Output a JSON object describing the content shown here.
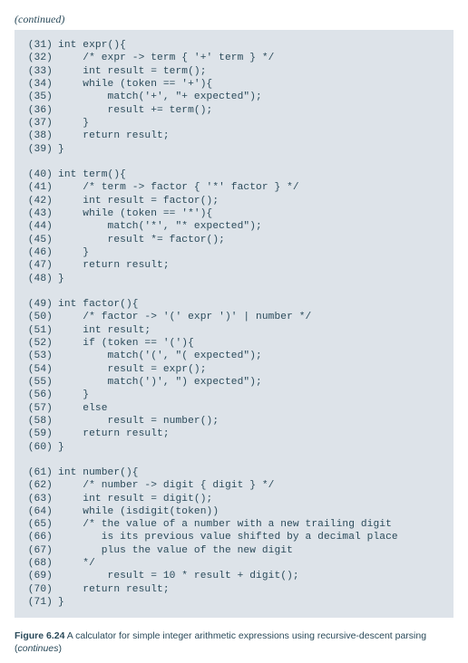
{
  "header": {
    "continued_label": "(continued)"
  },
  "code": {
    "lines": [
      {
        "n": "(31)",
        "t": "int expr(){"
      },
      {
        "n": "(32)",
        "t": "    /* expr -> term { '+' term } */"
      },
      {
        "n": "(33)",
        "t": "    int result = term();"
      },
      {
        "n": "(34)",
        "t": "    while (token == '+'){"
      },
      {
        "n": "(35)",
        "t": "        match('+', \"+ expected\");"
      },
      {
        "n": "(36)",
        "t": "        result += term();"
      },
      {
        "n": "(37)",
        "t": "    }"
      },
      {
        "n": "(38)",
        "t": "    return result;"
      },
      {
        "n": "(39)",
        "t": "}"
      },
      {
        "blank": true
      },
      {
        "n": "(40)",
        "t": "int term(){"
      },
      {
        "n": "(41)",
        "t": "    /* term -> factor { '*' factor } */"
      },
      {
        "n": "(42)",
        "t": "    int result = factor();"
      },
      {
        "n": "(43)",
        "t": "    while (token == '*'){"
      },
      {
        "n": "(44)",
        "t": "        match('*', \"* expected\");"
      },
      {
        "n": "(45)",
        "t": "        result *= factor();"
      },
      {
        "n": "(46)",
        "t": "    }"
      },
      {
        "n": "(47)",
        "t": "    return result;"
      },
      {
        "n": "(48)",
        "t": "}"
      },
      {
        "blank": true
      },
      {
        "n": "(49)",
        "t": "int factor(){"
      },
      {
        "n": "(50)",
        "t": "    /* factor -> '(' expr ')' | number */"
      },
      {
        "n": "(51)",
        "t": "    int result;"
      },
      {
        "n": "(52)",
        "t": "    if (token == '('){"
      },
      {
        "n": "(53)",
        "t": "        match('(', \"( expected\");"
      },
      {
        "n": "(54)",
        "t": "        result = expr();"
      },
      {
        "n": "(55)",
        "t": "        match(')', \") expected\");"
      },
      {
        "n": "(56)",
        "t": "    }"
      },
      {
        "n": "(57)",
        "t": "    else"
      },
      {
        "n": "(58)",
        "t": "        result = number();"
      },
      {
        "n": "(59)",
        "t": "    return result;"
      },
      {
        "n": "(60)",
        "t": "}"
      },
      {
        "blank": true
      },
      {
        "n": "(61)",
        "t": "int number(){"
      },
      {
        "n": "(62)",
        "t": "    /* number -> digit { digit } */"
      },
      {
        "n": "(63)",
        "t": "    int result = digit();"
      },
      {
        "n": "(64)",
        "t": "    while (isdigit(token))"
      },
      {
        "n": "(65)",
        "t": "    /* the value of a number with a new trailing digit"
      },
      {
        "n": "(66)",
        "t": "       is its previous value shifted by a decimal place"
      },
      {
        "n": "(67)",
        "t": "       plus the value of the new digit"
      },
      {
        "n": "(68)",
        "t": "    */"
      },
      {
        "n": "(69)",
        "t": "        result = 10 * result + digit();"
      },
      {
        "n": "(70)",
        "t": "    return result;"
      },
      {
        "n": "(71)",
        "t": "}"
      }
    ]
  },
  "caption": {
    "figlabel": "Figure 6.24",
    "text": " A calculator for simple integer arithmetic expressions using recursive-descent parsing (",
    "cont": "continues",
    "tail": ")"
  }
}
